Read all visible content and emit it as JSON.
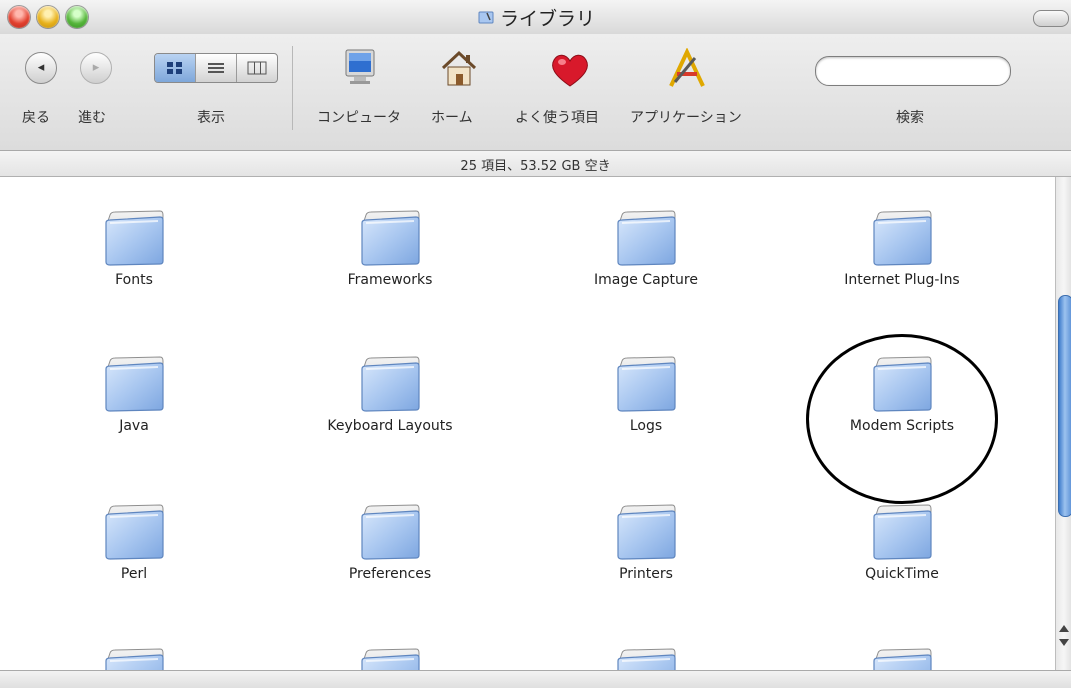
{
  "window": {
    "title": "ライブラリ"
  },
  "toolbar": {
    "back_label": "戻る",
    "forward_label": "進む",
    "view_label": "表示",
    "computer_label": "コンピュータ",
    "home_label": "ホーム",
    "favorites_label": "よく使う項目",
    "applications_label": "アプリケーション",
    "search_label": "検索",
    "search_value": ""
  },
  "status": {
    "text": "25 項目、53.52 GB 空き"
  },
  "items": [
    "Fonts",
    "Frameworks",
    "Image Capture",
    "Internet Plug-Ins",
    "Java",
    "Keyboard Layouts",
    "Logs",
    "Modem Scripts",
    "Perl",
    "Preferences",
    "Printers",
    "QuickTime"
  ],
  "annotation": {
    "highlighted_item": "Modem Scripts",
    "color": "#000000"
  }
}
